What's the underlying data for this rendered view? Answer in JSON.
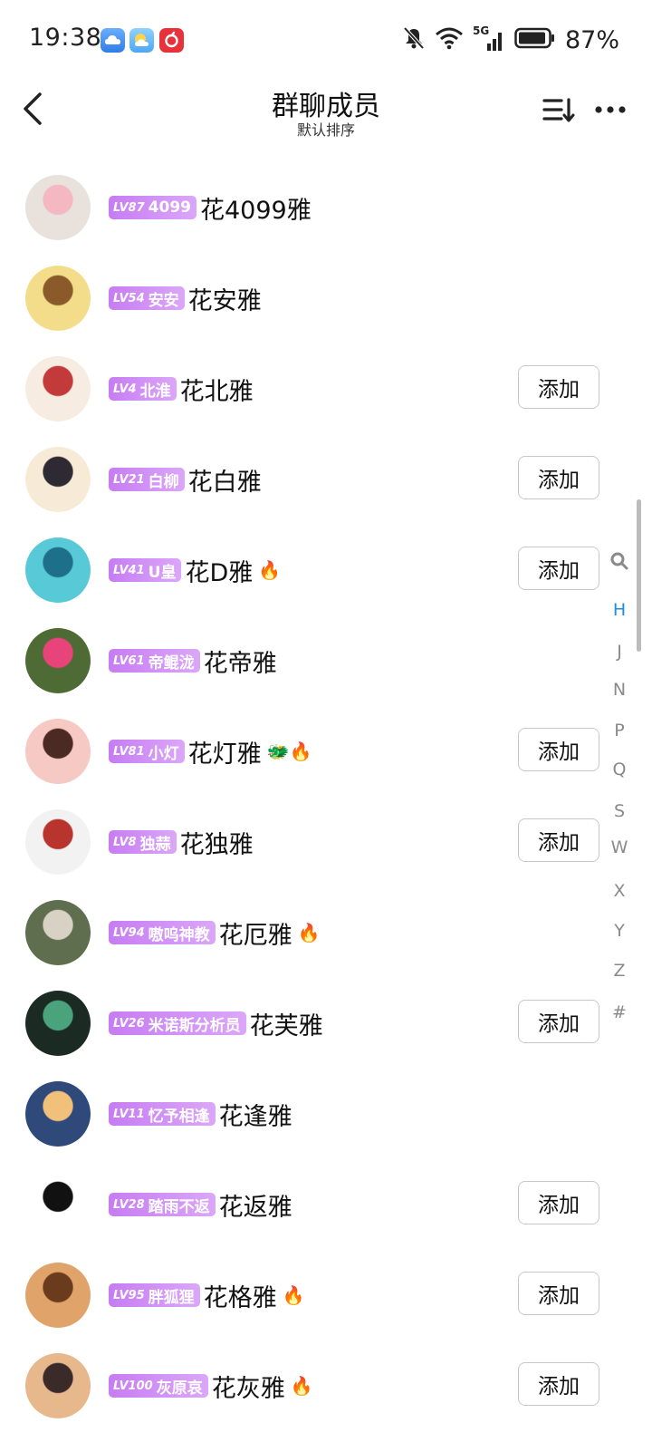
{
  "status_bar": {
    "time": "19:38",
    "signal_label": "5G",
    "battery": "87%"
  },
  "header": {
    "title": "群聊成员",
    "subtitle": "默认排序"
  },
  "add_label": "添加",
  "members": [
    {
      "lv": "LV87",
      "badge": "4099",
      "name": "花4099雅",
      "emoji": "",
      "has_add": false,
      "avatar_colors": [
        "#e9e1dc",
        "#f4b8c2"
      ]
    },
    {
      "lv": "LV54",
      "badge": "安安",
      "name": "花安雅",
      "emoji": "",
      "has_add": false,
      "avatar_colors": [
        "#f4dd8a",
        "#8a5a2a"
      ]
    },
    {
      "lv": "LV4",
      "badge": "北淮",
      "name": "花北雅",
      "emoji": "",
      "has_add": true,
      "avatar_colors": [
        "#f6ece2",
        "#c23a3a"
      ]
    },
    {
      "lv": "LV21",
      "badge": "白柳",
      "name": "花白雅",
      "emoji": "",
      "has_add": true,
      "avatar_colors": [
        "#f7ead7",
        "#2d2a33"
      ]
    },
    {
      "lv": "LV41",
      "badge": "U皇",
      "name": "花D雅",
      "emoji": "🔥",
      "has_add": true,
      "avatar_colors": [
        "#58c9d6",
        "#1e6f8a"
      ]
    },
    {
      "lv": "LV61",
      "badge": "帝鲲泷",
      "name": "花帝雅",
      "emoji": "",
      "has_add": false,
      "avatar_colors": [
        "#4f6b35",
        "#e8437a"
      ]
    },
    {
      "lv": "LV81",
      "badge": "小灯",
      "name": "花灯雅",
      "emoji": "🐲🔥",
      "has_add": true,
      "avatar_colors": [
        "#f7c9c4",
        "#4a2a22"
      ]
    },
    {
      "lv": "LV8",
      "badge": "独蒜",
      "name": "花独雅",
      "emoji": "",
      "has_add": true,
      "avatar_colors": [
        "#f2f2f2",
        "#b8352e"
      ]
    },
    {
      "lv": "LV94",
      "badge": "嗷呜神教",
      "name": "花厄雅",
      "emoji": "🔥",
      "has_add": false,
      "avatar_colors": [
        "#5f6e4e",
        "#d7d2c4"
      ]
    },
    {
      "lv": "LV26",
      "badge": "米诺斯分析员",
      "name": "花芙雅",
      "emoji": "",
      "has_add": true,
      "avatar_colors": [
        "#1c2a24",
        "#4aa37d"
      ]
    },
    {
      "lv": "LV11",
      "badge": "忆予相逢",
      "name": "花逢雅",
      "emoji": "",
      "has_add": false,
      "avatar_colors": [
        "#2f4a7a",
        "#f1c07a"
      ]
    },
    {
      "lv": "LV28",
      "badge": "踏雨不返",
      "name": "花返雅",
      "emoji": "",
      "has_add": true,
      "avatar_colors": [
        "#ffffff",
        "#111111"
      ]
    },
    {
      "lv": "LV95",
      "badge": "胖狐狸",
      "name": "花格雅",
      "emoji": "🔥",
      "has_add": true,
      "avatar_colors": [
        "#e0a46a",
        "#6b3b1e"
      ]
    },
    {
      "lv": "LV100",
      "badge": "灰原哀",
      "name": "花灰雅",
      "emoji": "🔥",
      "has_add": true,
      "avatar_colors": [
        "#e7b88c",
        "#3a2a2a"
      ]
    }
  ],
  "alphabet": [
    "H",
    "J",
    "N",
    "P",
    "Q",
    "S",
    "W",
    "X",
    "Y",
    "Z",
    "#"
  ],
  "alphabet_active": "H",
  "colors": {
    "badge": "#c77cf3",
    "active_letter": "#1a8fe0"
  }
}
